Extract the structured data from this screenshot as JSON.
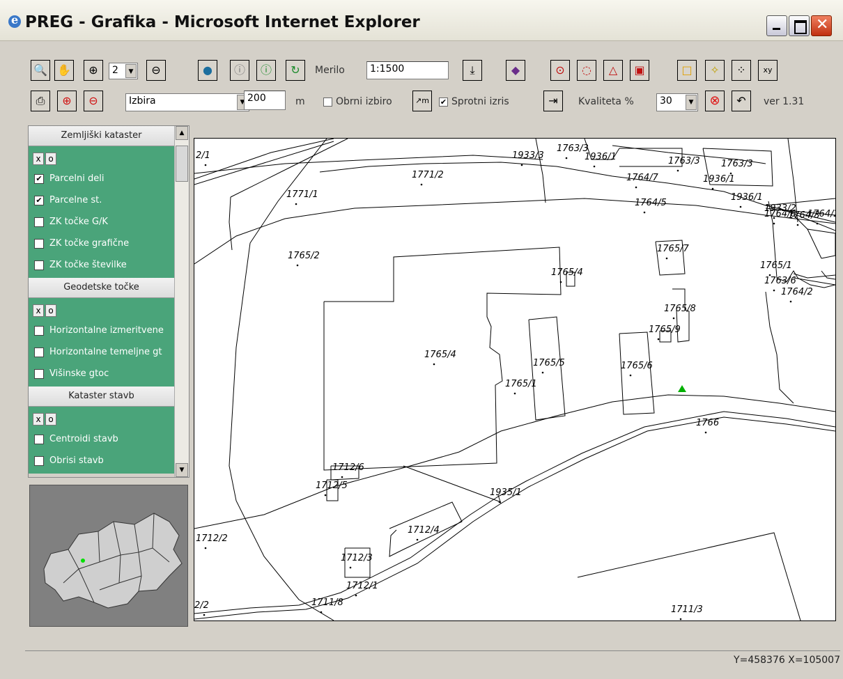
{
  "window": {
    "title": "PREG - Grafika - Microsoft Internet Explorer"
  },
  "toolbar": {
    "zoom_level": "2",
    "merilo_label": "Merilo",
    "scale_value": "1:1500",
    "selection_mode": "Izbira",
    "distance_value": "200",
    "distance_unit": "m",
    "obrni_izbiro_label": "Obrni izbiro",
    "sprotni_izris_label": "Sprotni izris",
    "sprotni_izris_checked": "✔",
    "kvaliteta_label": "Kvaliteta %",
    "quality_value": "30",
    "version": "ver 1.31"
  },
  "panel": {
    "sections": [
      {
        "title": "Zemljiški kataster",
        "layers": [
          {
            "label": "Parcelni deli",
            "mark": "✔"
          },
          {
            "label": "Parcelne st.",
            "mark": "✔"
          },
          {
            "label": "ZK točke G/K",
            "mark": ""
          },
          {
            "label": "ZK točke grafične",
            "mark": ""
          },
          {
            "label": "ZK točke številke",
            "mark": ""
          }
        ]
      },
      {
        "title": "Geodetske točke",
        "layers": [
          {
            "label": "Horizontalne izmeritvene",
            "mark": ""
          },
          {
            "label": "Horizontalne temeljne gt",
            "mark": ""
          },
          {
            "label": "Višinske gtoc",
            "mark": ""
          }
        ]
      },
      {
        "title": "Kataster stavb",
        "layers": [
          {
            "label": "Centroidi stavb",
            "mark": ""
          },
          {
            "label": "Obrisi stavb",
            "mark": ""
          }
        ]
      }
    ],
    "x_label": "x",
    "o_label": "o"
  },
  "map": {
    "labels": [
      "2/1",
      "1933/3",
      "1763/3",
      "1936/1",
      "1763/3",
      "1763/3",
      "1771/2",
      "1764/7",
      "1936/1",
      "1771/1",
      "1936/1",
      "1764/5",
      "1933/2",
      "1764/6",
      "1764/3",
      "1764/2",
      "1765/7",
      "1765/2",
      "1765/4",
      "1765/1",
      "1763/6",
      "1764/2",
      "1765/8",
      "1765/9",
      "1765/4",
      "1765/5",
      "1765/6",
      "1765/1",
      "1766",
      "1712/6",
      "1712/5",
      "1935/1",
      "1712/4",
      "1712/2",
      "1712/3",
      "1712/1",
      "1711/8",
      "1711/3",
      "2/2"
    ]
  },
  "status": {
    "coords": "Y=458376 X=105007"
  }
}
